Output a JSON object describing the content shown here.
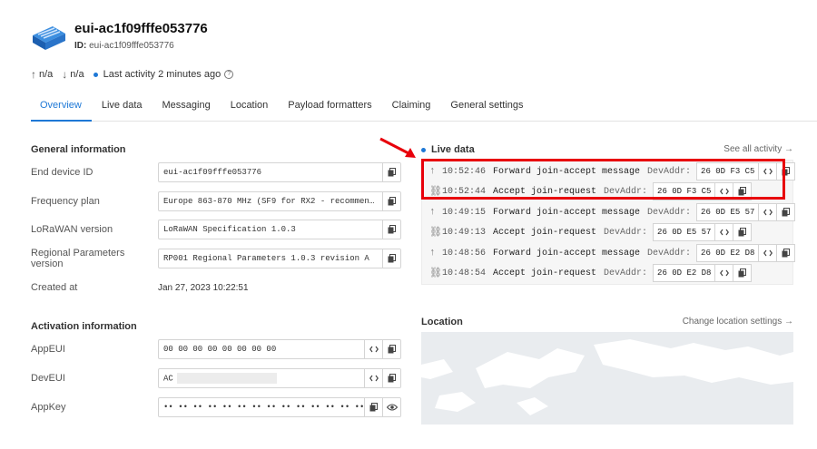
{
  "device": {
    "title": "eui-ac1f09fffe053776",
    "id_label": "ID:",
    "id_value": "eui-ac1f09fffe053776"
  },
  "stats": {
    "up": "n/a",
    "down": "n/a",
    "activity": "Last activity 2 minutes ago"
  },
  "tabs": [
    {
      "label": "Overview",
      "active": true
    },
    {
      "label": "Live data"
    },
    {
      "label": "Messaging"
    },
    {
      "label": "Location"
    },
    {
      "label": "Payload formatters"
    },
    {
      "label": "Claiming"
    },
    {
      "label": "General settings"
    }
  ],
  "general": {
    "heading": "General information",
    "rows": [
      {
        "label": "End device ID",
        "value": "eui-ac1f09fffe053776"
      },
      {
        "label": "Frequency plan",
        "value": "Europe 863-870 MHz (SF9 for RX2 - recommen…"
      },
      {
        "label": "LoRaWAN version",
        "value": "LoRaWAN Specification 1.0.3"
      },
      {
        "label": "Regional Parameters version",
        "value": "RP001 Regional Parameters 1.0.3 revision A"
      },
      {
        "label": "Created at",
        "value": "Jan 27, 2023 10:22:51"
      }
    ]
  },
  "activation": {
    "heading": "Activation information",
    "rows": [
      {
        "label": "AppEUI",
        "value": "00 00 00 00 00 00 00 00"
      },
      {
        "label": "DevEUI",
        "value": "AC"
      },
      {
        "label": "AppKey",
        "value": "•• •• •• •• •• •• •• •• •• •• •• •• •• •• •• ••"
      }
    ]
  },
  "live": {
    "heading": "Live data",
    "see_all": "See all activity →",
    "events": [
      {
        "icon": "arrow-up-icon",
        "time": "10:52:46",
        "message": "Forward join-accept message",
        "key": "DevAddr:",
        "addr": "26 0D F3 C5"
      },
      {
        "icon": "link-icon",
        "time": "10:52:44",
        "message": "Accept join-request",
        "key": "DevAddr:",
        "addr": "26 0D F3 C5"
      },
      {
        "icon": "arrow-up-icon",
        "time": "10:49:15",
        "message": "Forward join-accept message",
        "key": "DevAddr:",
        "addr": "26 0D E5 57"
      },
      {
        "icon": "link-icon",
        "time": "10:49:13",
        "message": "Accept join-request",
        "key": "DevAddr:",
        "addr": "26 0D E5 57"
      },
      {
        "icon": "arrow-up-icon",
        "time": "10:48:56",
        "message": "Forward join-accept message",
        "key": "DevAddr:",
        "addr": "26 0D E2 D8"
      },
      {
        "icon": "link-icon",
        "time": "10:48:54",
        "message": "Accept join-request",
        "key": "DevAddr:",
        "addr": "26 0D E2 D8"
      }
    ]
  },
  "location": {
    "heading": "Location",
    "link": "Change location settings →"
  },
  "colors": {
    "accent": "#1e78d6",
    "highlight": "#e8000b"
  }
}
